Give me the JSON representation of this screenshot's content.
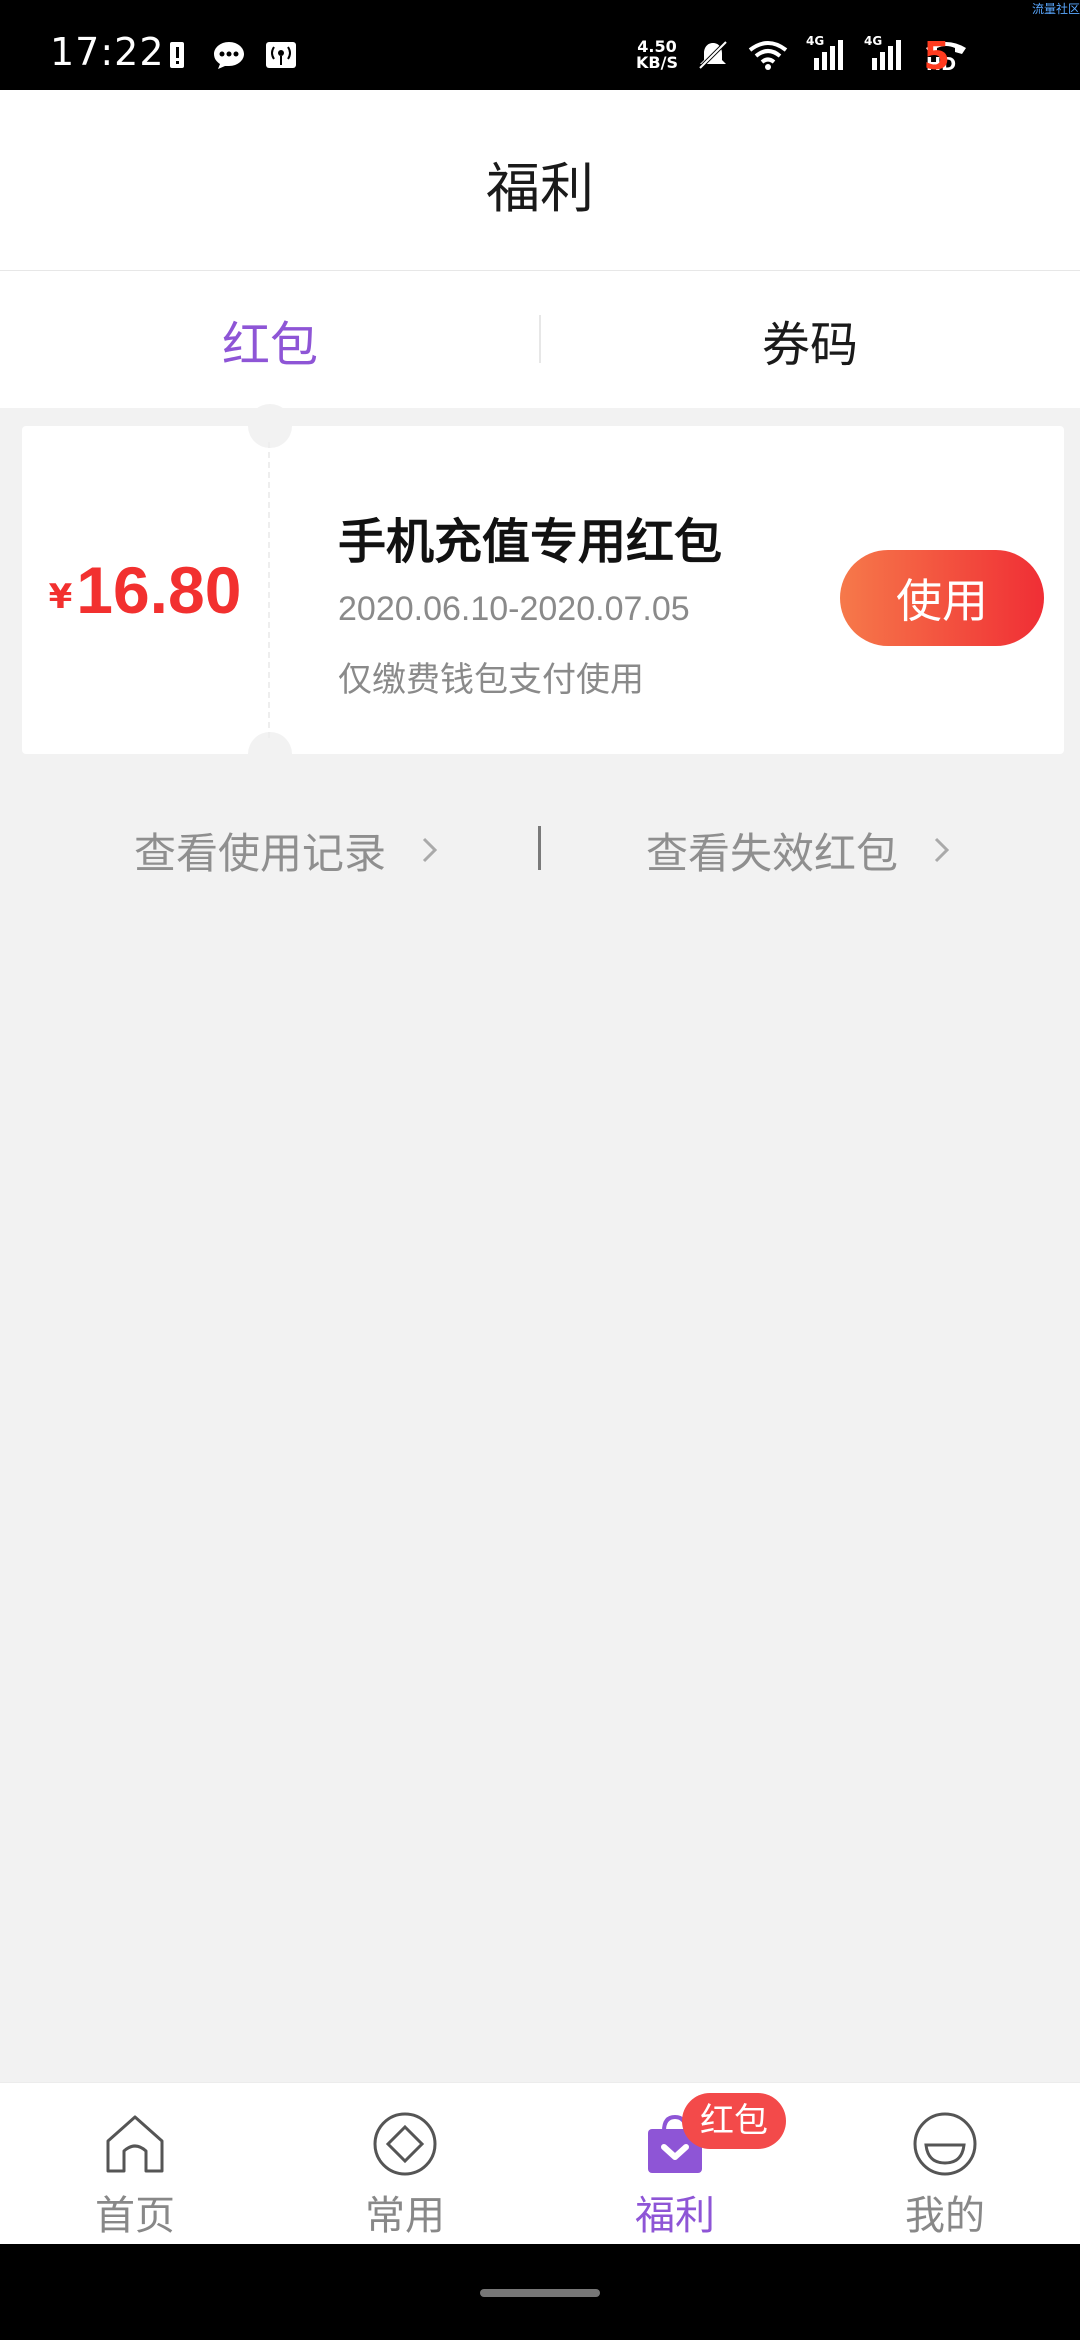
{
  "status_bar": {
    "time": "17:22",
    "network_speed_value": "4.50",
    "network_speed_unit": "KB/S",
    "signal_1": "4G",
    "signal_2": "4G",
    "hd_label": "HD",
    "battery": "5",
    "corner_text": "流量社区",
    "icons": [
      "sim-alert-icon",
      "message-icon",
      "broadcast-icon",
      "mute-icon",
      "wifi-icon",
      "signal-icon",
      "signal-icon",
      "call-hd-icon"
    ]
  },
  "header": {
    "title": "福利"
  },
  "tabs": {
    "items": [
      {
        "label": "红包",
        "active": true
      },
      {
        "label": "券码",
        "active": false
      }
    ],
    "active_color": "#8e55d6"
  },
  "coupon": {
    "currency": "¥",
    "amount": "16.80",
    "title": "手机充值专用红包",
    "dates": "2020.06.10-2020.07.05",
    "description": "仅缴费钱包支付使用",
    "use_label": "使用",
    "amount_color": "#f2302f"
  },
  "links": {
    "history_label": "查看使用记录",
    "expired_label": "查看失效红包"
  },
  "bottom_nav": {
    "items": [
      {
        "label": "首页",
        "icon": "home-icon",
        "active": false
      },
      {
        "label": "常用",
        "icon": "diamond-icon",
        "active": false
      },
      {
        "label": "福利",
        "icon": "gift-bag-icon",
        "active": true,
        "badge": "红包"
      },
      {
        "label": "我的",
        "icon": "smile-icon",
        "active": false
      }
    ]
  }
}
